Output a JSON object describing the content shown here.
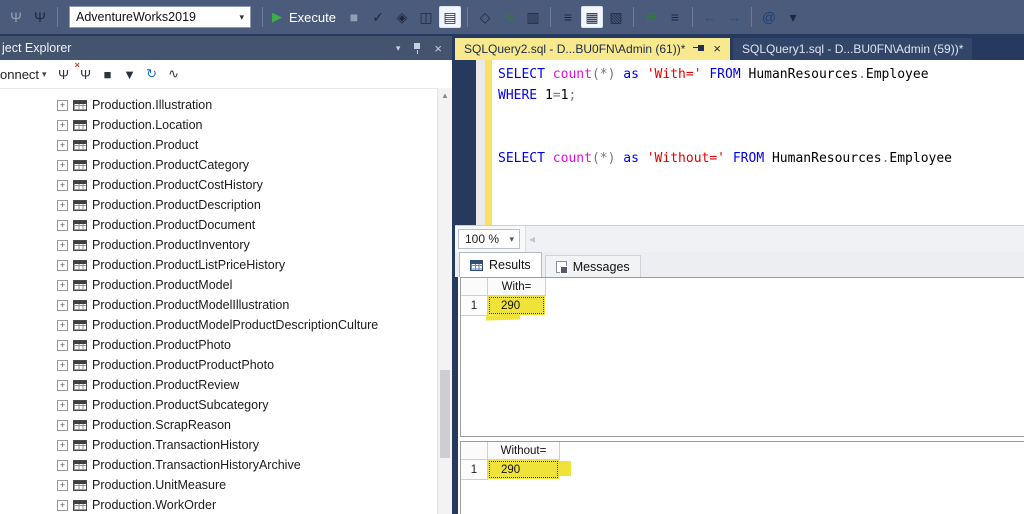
{
  "toolbar": {
    "connection_icons": [
      {
        "name": "connect-icon",
        "glyph": "Ψ",
        "disabled": true
      },
      {
        "name": "change-connection-icon",
        "glyph": "Ψ"
      }
    ],
    "database_combo": {
      "value": "AdventureWorks2019",
      "arrow": "▾"
    },
    "execute_button": {
      "icon": "▶",
      "label": "Execute"
    },
    "query_icons": [
      {
        "name": "cancel-query-icon",
        "glyph": "■",
        "disabled": true
      },
      {
        "name": "parse-query-icon",
        "glyph": "✓"
      },
      {
        "name": "estimated-plan-icon",
        "glyph": "◈"
      },
      {
        "name": "query-options-icon",
        "glyph": "◫"
      },
      {
        "name": "intellisense-enabled-icon",
        "glyph": "▤",
        "boxed": true
      },
      {
        "sep": true
      },
      {
        "name": "actual-plan-icon",
        "glyph": "◇"
      },
      {
        "name": "live-query-stats-icon",
        "glyph": "∿",
        "color": "#2f7d3a"
      },
      {
        "name": "client-statistics-icon",
        "glyph": "▥"
      },
      {
        "sep": true
      },
      {
        "name": "results-to-text-icon",
        "glyph": "≡"
      },
      {
        "name": "results-to-grid-icon",
        "glyph": "▦",
        "boxed": true
      },
      {
        "name": "results-to-file-icon",
        "glyph": "▧"
      },
      {
        "sep": true
      },
      {
        "name": "comment-icon",
        "glyph": "≣",
        "color": "#2f7d3a"
      },
      {
        "name": "uncomment-icon",
        "glyph": "≡"
      },
      {
        "sep": true
      },
      {
        "name": "decrease-indent-icon",
        "glyph": "←",
        "color": "#1d4f8f"
      },
      {
        "name": "increase-indent-icon",
        "glyph": "→",
        "color": "#1d4f8f"
      },
      {
        "sep": true
      },
      {
        "name": "specify-template-values-icon",
        "glyph": "@",
        "color": "#20406e"
      },
      {
        "name": "toolbar-overflow-icon",
        "glyph": "▾"
      }
    ]
  },
  "object_explorer": {
    "title": "ject Explorer",
    "titlebar": {
      "menu_arrow": "▾",
      "close": "×"
    },
    "explorer_toolbar": {
      "connect_label": "onnect",
      "connect_arrow": "▾",
      "icons": [
        {
          "name": "oe-connect-icon",
          "glyph": "Ψ"
        },
        {
          "name": "oe-disconnect-icon",
          "glyph": "Ψ",
          "overlay": "×"
        },
        {
          "name": "oe-stop-icon",
          "glyph": "■",
          "disabled": true
        },
        {
          "name": "oe-filter-icon",
          "glyph": "▼",
          "disabled": true
        },
        {
          "name": "oe-refresh-icon",
          "glyph": "↻",
          "color": "#1c6fd4"
        },
        {
          "name": "activity-monitor-icon",
          "glyph": "∿"
        }
      ]
    },
    "scroll_up_arrow": "▲",
    "tree_items": [
      "Production.Illustration",
      "Production.Location",
      "Production.Product",
      "Production.ProductCategory",
      "Production.ProductCostHistory",
      "Production.ProductDescription",
      "Production.ProductDocument",
      "Production.ProductInventory",
      "Production.ProductListPriceHistory",
      "Production.ProductModel",
      "Production.ProductModelIllustration",
      "Production.ProductModelProductDescriptionCulture",
      "Production.ProductPhoto",
      "Production.ProductProductPhoto",
      "Production.ProductReview",
      "Production.ProductSubcategory",
      "Production.ScrapReason",
      "Production.TransactionHistory",
      "Production.TransactionHistoryArchive",
      "Production.UnitMeasure",
      "Production.WorkOrder"
    ]
  },
  "editor": {
    "tabs": [
      {
        "label": "SQLQuery2.sql - D...BU0FN\\Admin (61))*",
        "close": "×",
        "active": true
      },
      {
        "label": "SQLQuery1.sql - D...BU0FN\\Admin (59))*",
        "active": false
      }
    ],
    "code_lines": [
      [
        [
          "kw",
          "SELECT"
        ],
        [
          "pl",
          " "
        ],
        [
          "fn",
          "count"
        ],
        [
          "gy",
          "("
        ],
        [
          "gy",
          "*"
        ],
        [
          "gy",
          ")"
        ],
        [
          "pl",
          " "
        ],
        [
          "kw",
          "as"
        ],
        [
          "pl",
          " "
        ],
        [
          "st",
          "'With='"
        ],
        [
          "pl",
          " "
        ],
        [
          "kw",
          "FROM"
        ],
        [
          "pl",
          " "
        ],
        [
          "pl",
          "HumanResources"
        ],
        [
          "gy",
          "."
        ],
        [
          "pl",
          "Employee"
        ]
      ],
      [
        [
          "kw",
          "WHERE"
        ],
        [
          "pl",
          " "
        ],
        [
          "pl",
          "1"
        ],
        [
          "gy",
          "="
        ],
        [
          "pl",
          "1"
        ],
        [
          "gy",
          ";"
        ]
      ],
      [],
      [],
      [
        [
          "kw",
          "SELECT"
        ],
        [
          "pl",
          " "
        ],
        [
          "fn",
          "count"
        ],
        [
          "gy",
          "("
        ],
        [
          "gy",
          "*"
        ],
        [
          "gy",
          ")"
        ],
        [
          "pl",
          " "
        ],
        [
          "kw",
          "as"
        ],
        [
          "pl",
          " "
        ],
        [
          "st",
          "'Without='"
        ],
        [
          "pl",
          " "
        ],
        [
          "kw",
          "FROM"
        ],
        [
          "pl",
          " "
        ],
        [
          "pl",
          "HumanResources"
        ],
        [
          "gy",
          "."
        ],
        [
          "pl",
          "Employee"
        ]
      ]
    ],
    "zoom_level": "100 %",
    "zoom_arrow": "▾",
    "hscroll_arrow": "◂"
  },
  "results": {
    "tabs": [
      {
        "label": "Results"
      },
      {
        "label": "Messages"
      }
    ],
    "grids": [
      {
        "column": "With=",
        "row_number": "1",
        "value": "290"
      },
      {
        "column": "Without=",
        "row_number": "1",
        "value": "290"
      }
    ]
  },
  "colors": {
    "toolbar_bg": "#4b5b7c",
    "panel_navy": "#253a5e",
    "titlebar_bg": "#44536e",
    "active_tab_yellow": "#f8e88e",
    "tracked_change_yellow": "#f8e263",
    "highlight_yellow": "#efe33a",
    "keyword_blue": "#0000f0",
    "function_magenta": "#e010e0",
    "string_red": "#e60000",
    "operator_gray": "#7a7a7a",
    "execute_green": "#3fae49"
  }
}
